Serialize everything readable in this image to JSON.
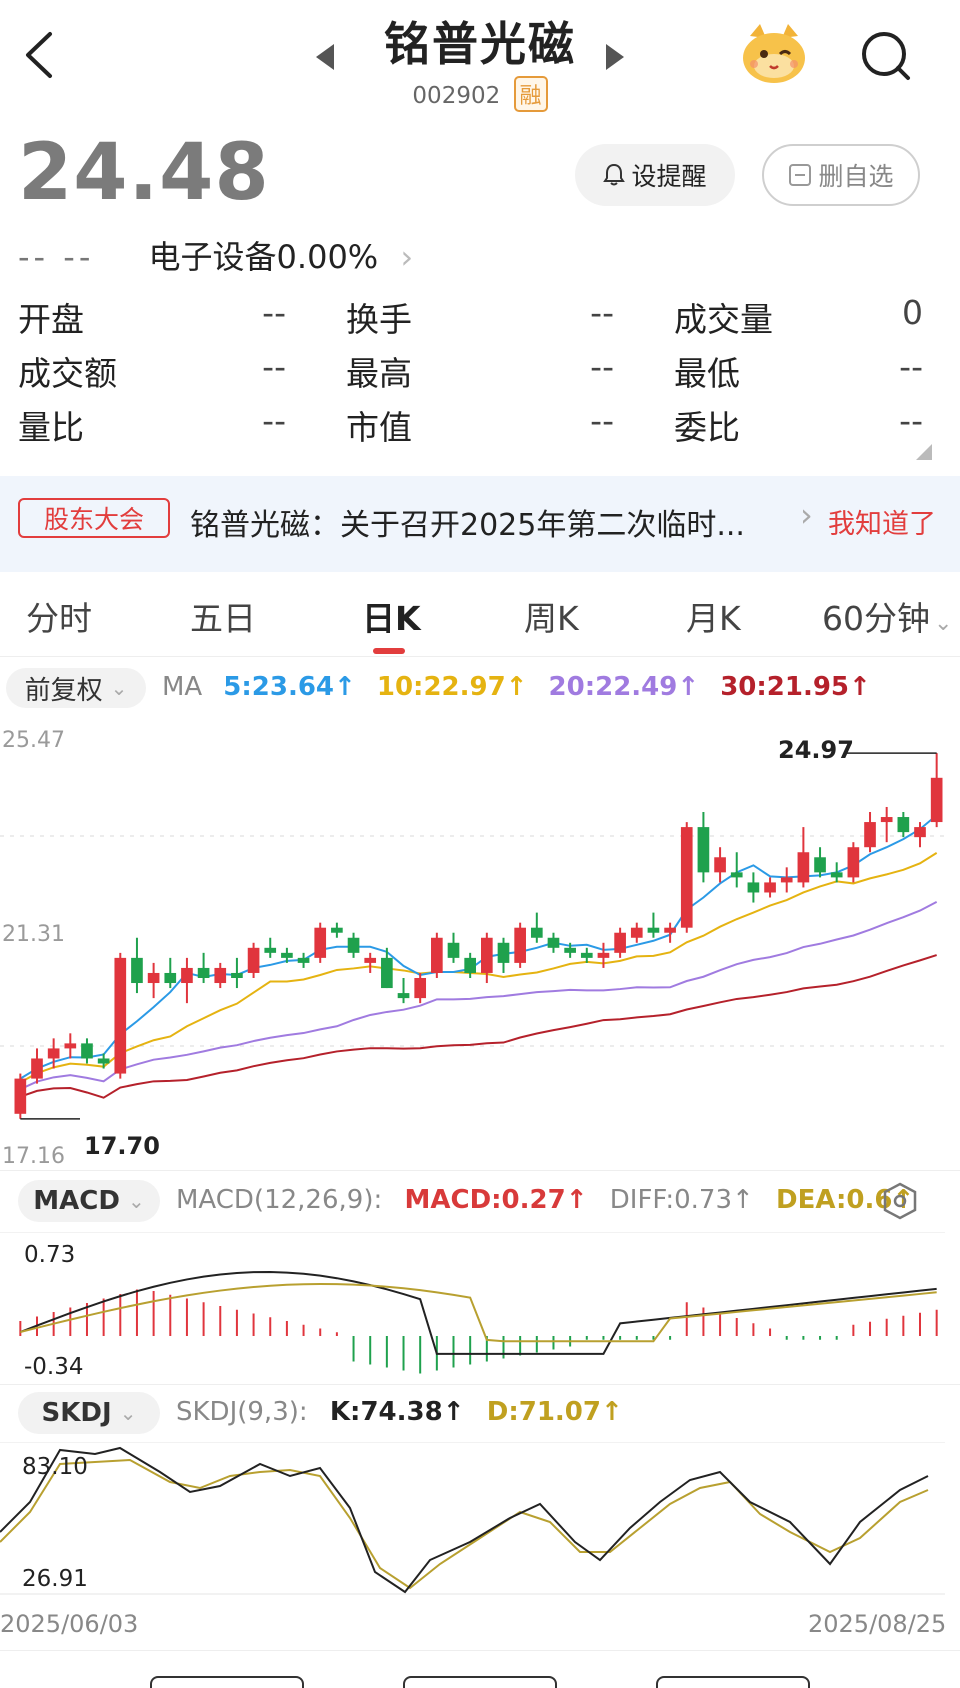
{
  "header": {
    "title": "铭普光磁",
    "code": "002902",
    "margin_badge": "融"
  },
  "quote": {
    "price": "24.48",
    "change": "-- --",
    "sector": "电子设备",
    "sector_change": "0.00%",
    "alert_label": "设提醒",
    "remove_label": "删自选"
  },
  "stats": [
    [
      {
        "k": "开盘",
        "v": "--"
      },
      {
        "k": "换手",
        "v": "--"
      },
      {
        "k": "成交量",
        "v": "0"
      }
    ],
    [
      {
        "k": "成交额",
        "v": "--"
      },
      {
        "k": "最高",
        "v": "--"
      },
      {
        "k": "最低",
        "v": "--"
      }
    ],
    [
      {
        "k": "量比",
        "v": "--"
      },
      {
        "k": "市值",
        "v": "--"
      },
      {
        "k": "委比",
        "v": "--"
      }
    ]
  ],
  "notice": {
    "tag": "股东大会",
    "text": "铭普光磁：关于召开2025年第二次临时...",
    "action": "我知道了"
  },
  "tabs": [
    "分时",
    "五日",
    "日K",
    "周K",
    "月K",
    "60分钟"
  ],
  "active_tab": "日K",
  "ma": {
    "adjust": "前复权",
    "label": "MA",
    "ma5": "5:23.64↑",
    "ma10": "10:22.97↑",
    "ma20": "20:22.49↑",
    "ma30": "30:21.95↑",
    "colors": {
      "ma5": "#2b9ae6",
      "ma10": "#e5b311",
      "ma20": "#a07be0",
      "ma30": "#b5212b"
    }
  },
  "kline_axis": {
    "top": "25.47",
    "mid": "21.31",
    "bottom": "17.16",
    "max_mark": "24.97",
    "min_mark": "17.70"
  },
  "macd": {
    "name": "MACD",
    "params": "MACD(12,26,9):",
    "macd": "MACD:0.27↑",
    "diff": "DIFF:0.73↑",
    "dea": "DEA:0.6↑",
    "axis_top": "0.73",
    "axis_bottom": "-0.34"
  },
  "skdj": {
    "name": "SKDJ",
    "params": "SKDJ(9,3):",
    "k": "K:74.38↑",
    "d": "D:71.07↑",
    "axis_top": "83.10",
    "axis_bottom": "26.91"
  },
  "dates": {
    "start": "2025/06/03",
    "end": "2025/08/25"
  },
  "chart_data": {
    "type": "candlestick",
    "ylim": [
      17.16,
      25.47
    ],
    "candles": [
      [
        17.8,
        18.6,
        17.7,
        18.5
      ],
      [
        18.5,
        19.1,
        18.4,
        18.9
      ],
      [
        18.9,
        19.3,
        18.7,
        19.1
      ],
      [
        19.1,
        19.4,
        18.9,
        19.2
      ],
      [
        19.2,
        19.3,
        18.8,
        18.9
      ],
      [
        18.9,
        19.0,
        18.7,
        18.8
      ],
      [
        18.6,
        21.0,
        18.5,
        20.9
      ],
      [
        20.9,
        21.3,
        20.2,
        20.4
      ],
      [
        20.4,
        20.8,
        20.1,
        20.6
      ],
      [
        20.6,
        20.9,
        20.3,
        20.4
      ],
      [
        20.4,
        20.9,
        20.0,
        20.7
      ],
      [
        20.7,
        21.0,
        20.4,
        20.5
      ],
      [
        20.4,
        20.8,
        20.3,
        20.7
      ],
      [
        20.6,
        20.9,
        20.3,
        20.5
      ],
      [
        20.6,
        21.2,
        20.5,
        21.1
      ],
      [
        21.1,
        21.3,
        20.9,
        21.0
      ],
      [
        21.0,
        21.1,
        20.8,
        20.9
      ],
      [
        20.9,
        21.0,
        20.7,
        20.8
      ],
      [
        20.9,
        21.6,
        20.8,
        21.5
      ],
      [
        21.5,
        21.6,
        21.3,
        21.4
      ],
      [
        21.3,
        21.4,
        20.9,
        21.0
      ],
      [
        20.8,
        21.0,
        20.6,
        20.9
      ],
      [
        20.9,
        21.1,
        20.3,
        20.3
      ],
      [
        20.2,
        20.5,
        20.0,
        20.1
      ],
      [
        20.1,
        20.6,
        20.0,
        20.5
      ],
      [
        20.6,
        21.4,
        20.5,
        21.3
      ],
      [
        21.2,
        21.4,
        20.8,
        20.9
      ],
      [
        20.9,
        21.0,
        20.5,
        20.6
      ],
      [
        20.6,
        21.4,
        20.4,
        21.3
      ],
      [
        21.2,
        21.3,
        20.6,
        20.8
      ],
      [
        20.8,
        21.6,
        20.7,
        21.5
      ],
      [
        21.5,
        21.8,
        21.2,
        21.3
      ],
      [
        21.3,
        21.4,
        21.0,
        21.1
      ],
      [
        21.1,
        21.2,
        20.9,
        21.0
      ],
      [
        21.0,
        21.1,
        20.8,
        20.9
      ],
      [
        20.9,
        21.2,
        20.7,
        21.0
      ],
      [
        21.0,
        21.5,
        20.9,
        21.4
      ],
      [
        21.3,
        21.6,
        21.2,
        21.5
      ],
      [
        21.5,
        21.8,
        21.3,
        21.4
      ],
      [
        21.4,
        21.6,
        21.2,
        21.5
      ],
      [
        21.5,
        23.6,
        21.4,
        23.5
      ],
      [
        23.5,
        23.8,
        22.4,
        22.6
      ],
      [
        22.6,
        23.1,
        22.4,
        22.9
      ],
      [
        22.6,
        23.0,
        22.3,
        22.5
      ],
      [
        22.4,
        22.6,
        22.0,
        22.2
      ],
      [
        22.2,
        22.5,
        22.1,
        22.4
      ],
      [
        22.4,
        22.7,
        22.2,
        22.5
      ],
      [
        22.4,
        23.5,
        22.3,
        23.0
      ],
      [
        22.9,
        23.1,
        22.5,
        22.6
      ],
      [
        22.6,
        22.8,
        22.4,
        22.5
      ],
      [
        22.5,
        23.2,
        22.4,
        23.1
      ],
      [
        23.1,
        23.8,
        23.0,
        23.6
      ],
      [
        23.6,
        23.9,
        23.2,
        23.7
      ],
      [
        23.7,
        23.8,
        23.3,
        23.4
      ],
      [
        23.3,
        23.6,
        23.1,
        23.5
      ],
      [
        23.6,
        24.97,
        23.5,
        24.48
      ]
    ]
  }
}
